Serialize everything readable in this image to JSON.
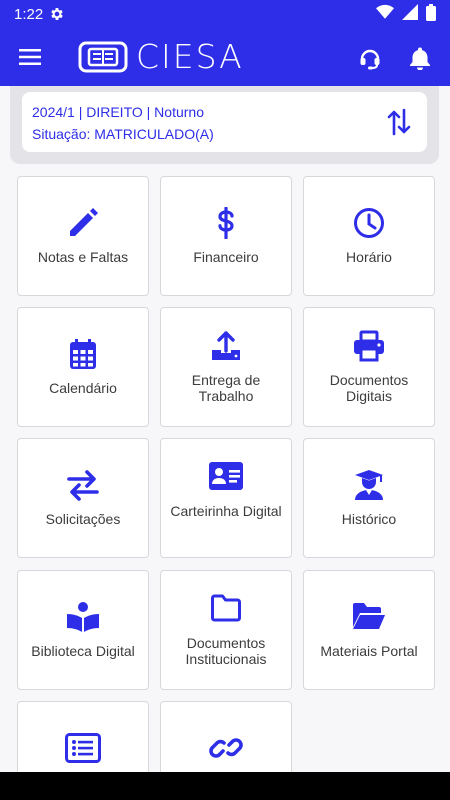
{
  "status_bar": {
    "time": "1:22"
  },
  "app": {
    "brand": "CIESA"
  },
  "course": {
    "line1": "2024/1 | DIREITO | Noturno",
    "line2": "Situação: MATRICULADO(A)"
  },
  "menu_tiles": [
    {
      "label": "Notas e Faltas",
      "icon": "pencil-icon"
    },
    {
      "label": "Financeiro",
      "icon": "dollar-icon"
    },
    {
      "label": "Horário",
      "icon": "clock-icon"
    },
    {
      "label": "Calendário",
      "icon": "calendar-icon"
    },
    {
      "label": "Entrega de Trabalho",
      "icon": "upload-icon"
    },
    {
      "label": "Documentos Digitais",
      "icon": "printer-icon"
    },
    {
      "label": "Solicitações",
      "icon": "exchange-icon"
    },
    {
      "label": "Carteirinha Digital",
      "icon": "id-card-icon"
    },
    {
      "label": "Histórico",
      "icon": "graduate-icon"
    },
    {
      "label": "Biblioteca Digital",
      "icon": "reader-icon"
    },
    {
      "label": "Documentos Institucionais",
      "icon": "folder-icon"
    },
    {
      "label": "Materiais Portal",
      "icon": "folder-open-icon"
    },
    {
      "label": "",
      "icon": "list-icon"
    },
    {
      "label": "",
      "icon": "link-icon"
    }
  ],
  "colors": {
    "primary": "#2e2ee8",
    "tile_border": "#d8d8dc",
    "background": "#f7f7f9"
  }
}
